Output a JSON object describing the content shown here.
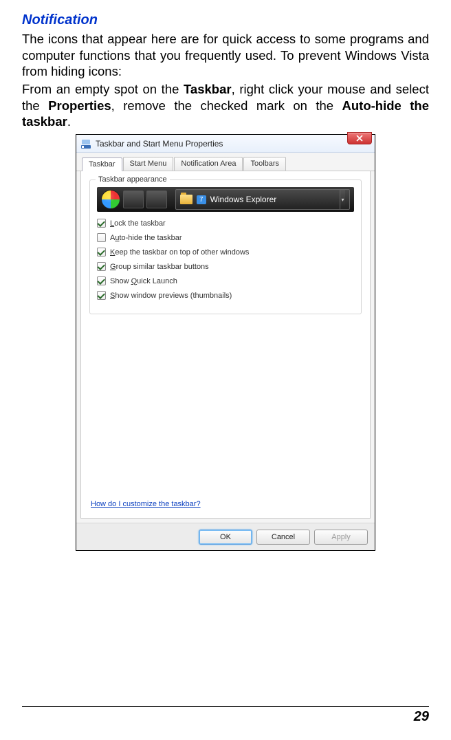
{
  "heading": "Notification",
  "para1": "The icons that appear here are for quick access to some programs and computer functions that you frequently used. To prevent Windows Vista from hiding icons:",
  "para2_pre": "From an empty spot on the ",
  "para2_b1": "Taskbar",
  "para2_mid1": ", right click your mouse and select the ",
  "para2_b2": "Properties",
  "para2_mid2": ", remove the checked mark on the ",
  "para2_b3": "Auto-hide the taskbar",
  "para2_end": ".",
  "dialog": {
    "title": "Taskbar and Start Menu Properties",
    "tabs": [
      "Taskbar",
      "Start Menu",
      "Notification Area",
      "Toolbars"
    ],
    "group_label": "Taskbar appearance",
    "explorer_num": "7",
    "explorer_label": "Windows Explorer",
    "checkboxes": [
      {
        "checked": true,
        "pre": "",
        "u": "L",
        "post": "ock the taskbar"
      },
      {
        "checked": false,
        "pre": "A",
        "u": "u",
        "post": "to-hide the taskbar"
      },
      {
        "checked": true,
        "pre": "",
        "u": "K",
        "post": "eep the taskbar on top of other windows"
      },
      {
        "checked": true,
        "pre": "",
        "u": "G",
        "post": "roup similar taskbar buttons"
      },
      {
        "checked": true,
        "pre": "Show ",
        "u": "Q",
        "post": "uick Launch"
      },
      {
        "checked": true,
        "pre": "",
        "u": "S",
        "post": "how window previews (thumbnails)"
      }
    ],
    "help_link": "How do I customize the taskbar?",
    "buttons": {
      "ok": "OK",
      "cancel": "Cancel",
      "apply": "Apply"
    }
  },
  "page_number": "29"
}
